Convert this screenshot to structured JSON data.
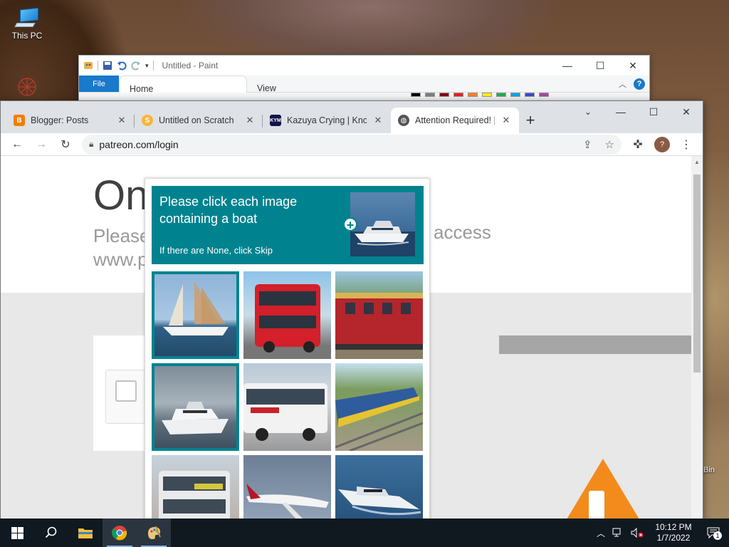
{
  "desktop": {
    "icon_this_pc": "This PC",
    "bin_partial_label": "Bin"
  },
  "paint": {
    "title": "Untitled - Paint",
    "tabs": {
      "file": "File",
      "home": "Home",
      "view": "View"
    },
    "help": "?"
  },
  "chrome": {
    "tabs": [
      {
        "label": "Blogger: Posts",
        "icon": "blogger-icon"
      },
      {
        "label": "Untitled on Scratch",
        "icon": "scratch-icon"
      },
      {
        "label": "Kazuya Crying | Know",
        "icon": "kym-icon"
      },
      {
        "label": "Attention Required! |",
        "icon": "globe-icon",
        "active": true
      }
    ],
    "new_tab": "+",
    "url": "patreon.com/login",
    "avatar_initial": "?"
  },
  "page": {
    "heading_partial": "On",
    "sub_partial_left": "Please",
    "sub_partial_right": "access",
    "sub_line2_partial": "www.p"
  },
  "captcha": {
    "title": "Please click each image containing a boat",
    "hint": "If there are None, click Skip",
    "cells": [
      {
        "subject": "sailboat",
        "selected": true
      },
      {
        "subject": "red double-decker bus",
        "selected": false
      },
      {
        "subject": "red train",
        "selected": false
      },
      {
        "subject": "white motor yacht",
        "selected": true
      },
      {
        "subject": "white bus",
        "selected": false
      },
      {
        "subject": "blue train",
        "selected": false
      },
      {
        "subject": "double-decker bus",
        "selected": false
      },
      {
        "subject": "airplane",
        "selected": false
      },
      {
        "subject": "speedboat",
        "selected": false
      }
    ]
  },
  "taskbar": {
    "time": "10:12 PM",
    "date": "1/7/2022",
    "notification_count": "1"
  }
}
